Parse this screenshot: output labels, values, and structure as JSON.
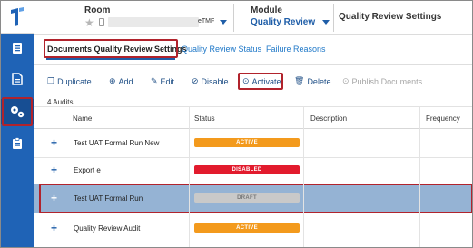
{
  "header": {
    "room_label": "Room",
    "room_value_suffix": "eTMF",
    "module_label": "Module",
    "module_value": "Quality Review",
    "page_heading": "Quality Review Settings"
  },
  "tabs": [
    {
      "label": "Documents Quality Review Settings",
      "active": true
    },
    {
      "label": "Quality Review Status",
      "active": false
    },
    {
      "label": "Failure Reasons",
      "active": false
    }
  ],
  "toolbar": {
    "duplicate": "Duplicate",
    "add": "Add",
    "edit": "Edit",
    "disable": "Disable",
    "activate": "Activate",
    "delete": "Delete",
    "publish": "Publish Documents"
  },
  "audits_count": "4 Audits",
  "table": {
    "columns": [
      "Name",
      "Status",
      "Description",
      "Frequency"
    ],
    "rows": [
      {
        "name": "Test UAT Formal Run New",
        "status": "ACTIVE"
      },
      {
        "name": "Export e",
        "status": "DISABLED"
      },
      {
        "name": "Test UAT Formal Run",
        "status": "DRAFT"
      },
      {
        "name": "Quality Review Audit",
        "status": "ACTIVE"
      }
    ]
  },
  "colors": {
    "brand_blue": "#1f63b6",
    "link_blue": "#1f78c8",
    "highlight_red": "#b1232c",
    "active_orange": "#f39a1d",
    "disabled_red": "#e21b2d",
    "draft_gray": "#c9c9c9",
    "selected_row": "#95b3d4"
  },
  "icons": [
    "app-logo-icon",
    "document-icon",
    "file-icon",
    "gears-icon",
    "clipboard-icon",
    "star-icon",
    "mobile-icon",
    "chevron-down-icon",
    "duplicate-icon",
    "add-icon",
    "edit-icon",
    "disable-icon",
    "activate-icon",
    "delete-icon",
    "publish-icon",
    "expand-icon"
  ]
}
